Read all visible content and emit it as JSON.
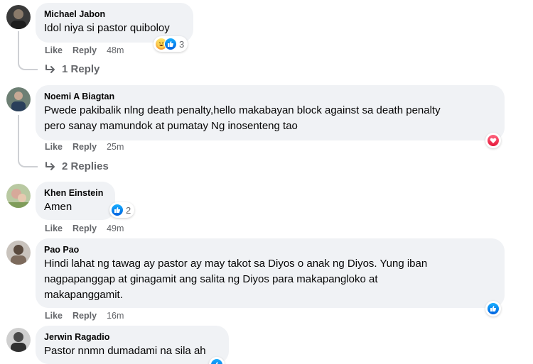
{
  "comments": [
    {
      "author": "Michael Jabon",
      "text": "Idol niya si pastor quiboloy",
      "like": "Like",
      "reply": "Reply",
      "time": "48m",
      "reaction_count": "3",
      "reactions": [
        "haha-icon",
        "like-icon"
      ],
      "replies": "1 Reply"
    },
    {
      "author": "Noemi A Biagtan",
      "text_lines": [
        "Pwede pakibalik nlng death penalty,hello makabayan block against sa death penalty",
        "pero sanay mamundok at pumatay Ng inosenteng tao"
      ],
      "like": "Like",
      "reply": "Reply",
      "time": "25m",
      "reactions": [
        "love-icon"
      ],
      "replies": "2 Replies"
    },
    {
      "author": "Khen Einstein",
      "text": "Amen",
      "like": "Like",
      "reply": "Reply",
      "time": "49m",
      "reaction_count": "2",
      "reactions": [
        "like-icon"
      ]
    },
    {
      "author": "Pao Pao",
      "text_lines": [
        "Hindi lahat ng tawag ay pastor ay may takot sa Diyos o anak ng Diyos. Yung iban",
        "nagpapanggap at ginagamit ang salita ng Diyos para makapangloko at",
        "makapanggamit."
      ],
      "like": "Like",
      "reply": "Reply",
      "time": "16m",
      "reactions": [
        "like-icon"
      ]
    },
    {
      "author": "Jerwin Ragadio",
      "text": "Pastor nnmn dumadami na sila ah",
      "reactions": [
        "like-icon"
      ]
    }
  ],
  "colors": {
    "bubble": "#f0f2f5",
    "meta": "#65676b",
    "like": "#1877f2",
    "love": "#f33e58"
  }
}
